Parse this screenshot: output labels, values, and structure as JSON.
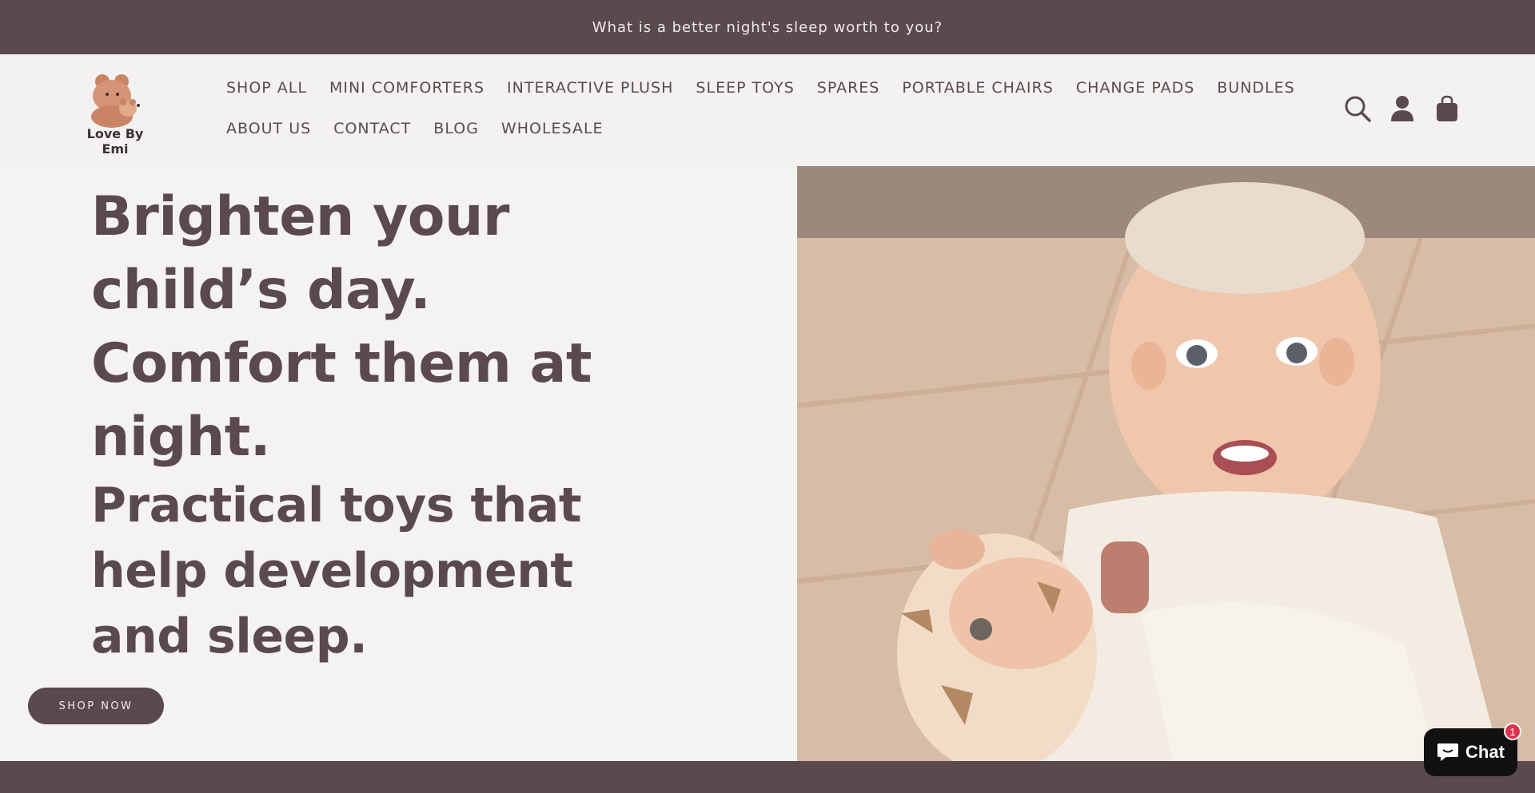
{
  "announcement": {
    "text": "What is a better night's sleep worth to you?"
  },
  "header": {
    "logo_text": "Love By Emi",
    "nav_row1": [
      "SHOP ALL",
      "MINI COMFORTERS",
      "INTERACTIVE PLUSH",
      "SLEEP TOYS",
      "SPARES",
      "PORTABLE CHAIRS",
      "CHANGE PADS",
      "BUNDLES"
    ],
    "nav_row2": [
      "ABOUT US",
      "CONTACT",
      "BLOG",
      "WHOLESALE"
    ],
    "icons": [
      "search-icon",
      "account-icon",
      "cart-icon"
    ]
  },
  "hero": {
    "headline": "Brighten your child’s day. Comfort them at night.",
    "subhead": "Practical toys that help development and sleep.",
    "cta_label": "SHOP NOW",
    "image_description_icon": "baby-with-giraffe-plush-photo"
  },
  "chat": {
    "label": "Chat",
    "badge_count": "1"
  },
  "colors": {
    "brand": "#5a4a4d",
    "background": "#f4f2f0",
    "chat_bg": "#111111",
    "badge": "#e0314e"
  }
}
